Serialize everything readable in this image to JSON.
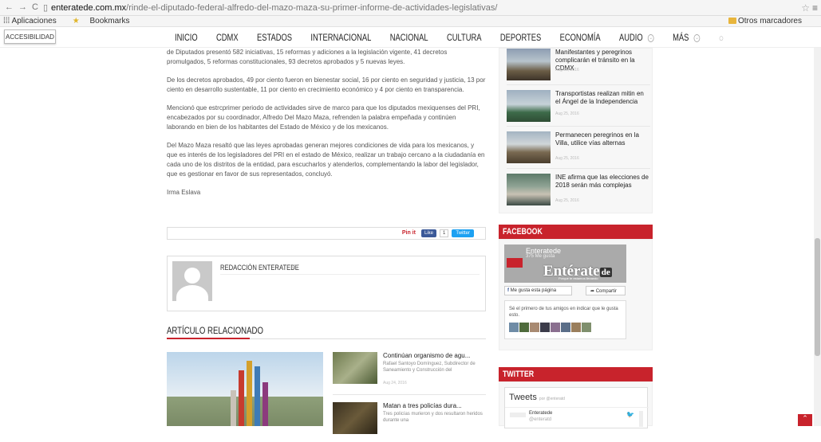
{
  "browser": {
    "url_domain": "enteratede.com.mx",
    "url_path": "/rinde-el-diputado-federal-alfredo-del-mazo-maza-su-primer-informe-de-actividades-legislativas/",
    "bookmarks": [
      "Aplicaciones",
      "Bookmarks"
    ],
    "other_bookmarks": "Otros marcadores"
  },
  "accessibility_label": "ACCESIBILIDAD",
  "nav": {
    "items": [
      "INICIO",
      "CDMX",
      "ESTADOS",
      "INTERNACIONAL",
      "NACIONAL",
      "CULTURA",
      "DEPORTES",
      "ECONOMÍA",
      "AUDIO",
      "MÁS"
    ]
  },
  "article": {
    "paragraphs": [
      "de Diputados presentó 582 iniciativas, 15 reformas y adiciones a la legislación vigente, 41 decretos promulgados, 5 reformas constitucionales, 93 decretos aprobados y 5 nuevas leyes.",
      "De los decretos aprobados, 49 por ciento fueron en bienestar social, 16 por ciento en seguridad y justicia, 13 por ciento en desarrollo sustentable, 11 por ciento en crecimiento económico y 4 por ciento en transparencia.",
      "Mencionó que estrcprimer periodo de actividades sirve de marco para que los diputados mexiquenses del PRI, encabezados por su coordinador, Alfredo Del Mazo Maza, refrenden la palabra empeñada y continúen laborando en bien de los habitantes del Estado de México y de los mexicanos.",
      "Del Mazo Maza resaltó  que las leyes aprobadas  generan mejores condiciones de vida para los mexicanos, y que es  interés de los legisladores del PRI en el estado de México, realizar un trabajo cercano a la ciudadanía en cada uno de los distritos de la entidad, para escucharlos y atenderlos, complementando la labor del legislador, que es gestionar en favor de sus representados, concluyó.",
      "Irma Eslava"
    ]
  },
  "share": {
    "pin": "Pin it",
    "like": "Like",
    "like_count": "1",
    "tweet": "Twitter"
  },
  "author": {
    "name": "REDACCIÓN ENTERATEDE"
  },
  "related": {
    "title": "ARTÍCULO RELACIONADO",
    "items": [
      {
        "title": "Continúan organismo de agu...",
        "desc": "Rafael Santoyo Domínguez, Subdirector de Saneamiento y Construcción del",
        "date": "Aug 24, 2016"
      },
      {
        "title": "Matan a tres policías dura...",
        "desc": "Tres policías murieron y dos resultaron heridos durante una",
        "date": ""
      }
    ]
  },
  "sidebar_news": [
    {
      "title": "Manifestantes y peregrinos complicarán el tránsito en la CDMX",
      "date": "Aug 25, 2016"
    },
    {
      "title": "Transportistas realizan mitin en el Ángel de la Independencia",
      "date": "Aug 25, 2016"
    },
    {
      "title": "Permanecen peregrinos en la Villa, utilice vías alternas",
      "date": "Aug 25, 2016"
    },
    {
      "title": "INE afirma que las elecciones de 2018 serán más complejas",
      "date": "Aug 25, 2016"
    }
  ],
  "facebook": {
    "heading": "FACEBOOK",
    "page_name": "Enteratede",
    "likes": "375 Me gusta",
    "logo": "Entérate",
    "logo_de": "de",
    "tagline": "Porque te estamos llevando",
    "like_btn": "Me gusta esta página",
    "share_btn": "Compartir",
    "friends_text": "Sé el primero de tus amigos en indicar que le gusta esto."
  },
  "twitter": {
    "heading": "TWITTER",
    "tweets_label": "Tweets",
    "by": "por @enteratd",
    "account": "Enteratede",
    "handle": "@enteratd"
  },
  "colors": {
    "accent": "#c8232c"
  }
}
